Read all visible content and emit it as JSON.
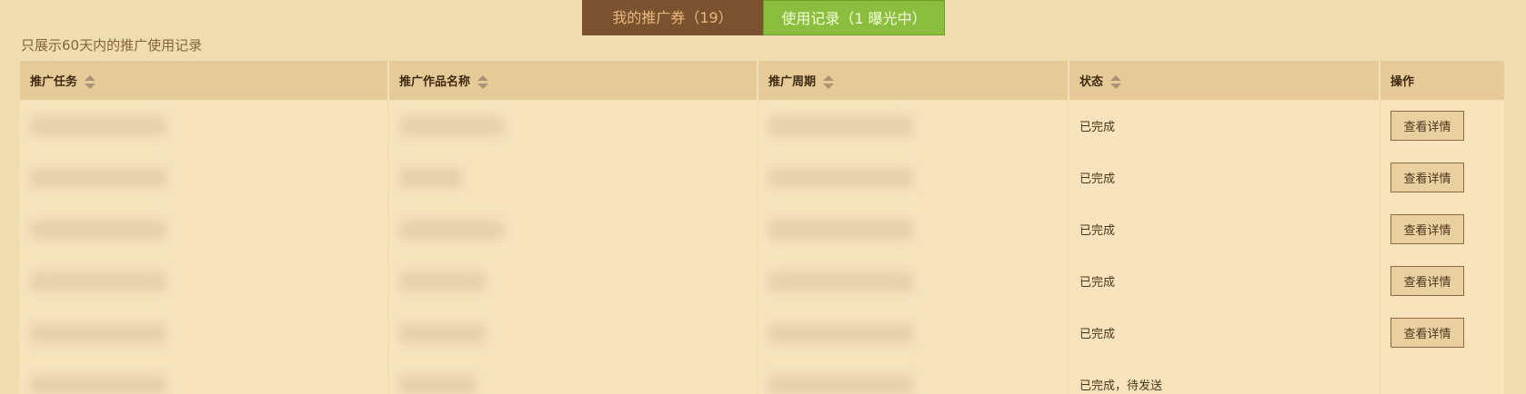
{
  "tabs": [
    {
      "label": "我的推广券（19）",
      "active": false
    },
    {
      "label": "使用记录（1 曝光中）",
      "active": true
    }
  ],
  "notice": "只展示60天内的推广使用记录",
  "table": {
    "columns": [
      {
        "label": "推广任务",
        "sortable": true
      },
      {
        "label": "推广作品名称",
        "sortable": true
      },
      {
        "label": "推广周期",
        "sortable": true
      },
      {
        "label": "状态",
        "sortable": true
      },
      {
        "label": "操作",
        "sortable": false
      }
    ],
    "rows": [
      {
        "task": "",
        "work": "",
        "period": "",
        "status": "已完成",
        "action": "查看详情"
      },
      {
        "task": "",
        "work": "",
        "period": "",
        "status": "已完成",
        "action": "查看详情"
      },
      {
        "task": "",
        "work": "",
        "period": "",
        "status": "已完成",
        "action": "查看详情"
      },
      {
        "task": "",
        "work": "",
        "period": "",
        "status": "已完成",
        "action": "查看详情"
      },
      {
        "task": "",
        "work": "",
        "period": "",
        "status": "已完成",
        "action": "查看详情"
      },
      {
        "task": "",
        "work": "",
        "period": "",
        "status": "已完成，待发送",
        "action": ""
      }
    ]
  },
  "colors": {
    "background": "#efdcaf",
    "tab_inactive": "#7b5230",
    "tab_active": "#8bbd3e",
    "header_bg": "#e6cb98",
    "row_bg": "#f7e3bc"
  }
}
